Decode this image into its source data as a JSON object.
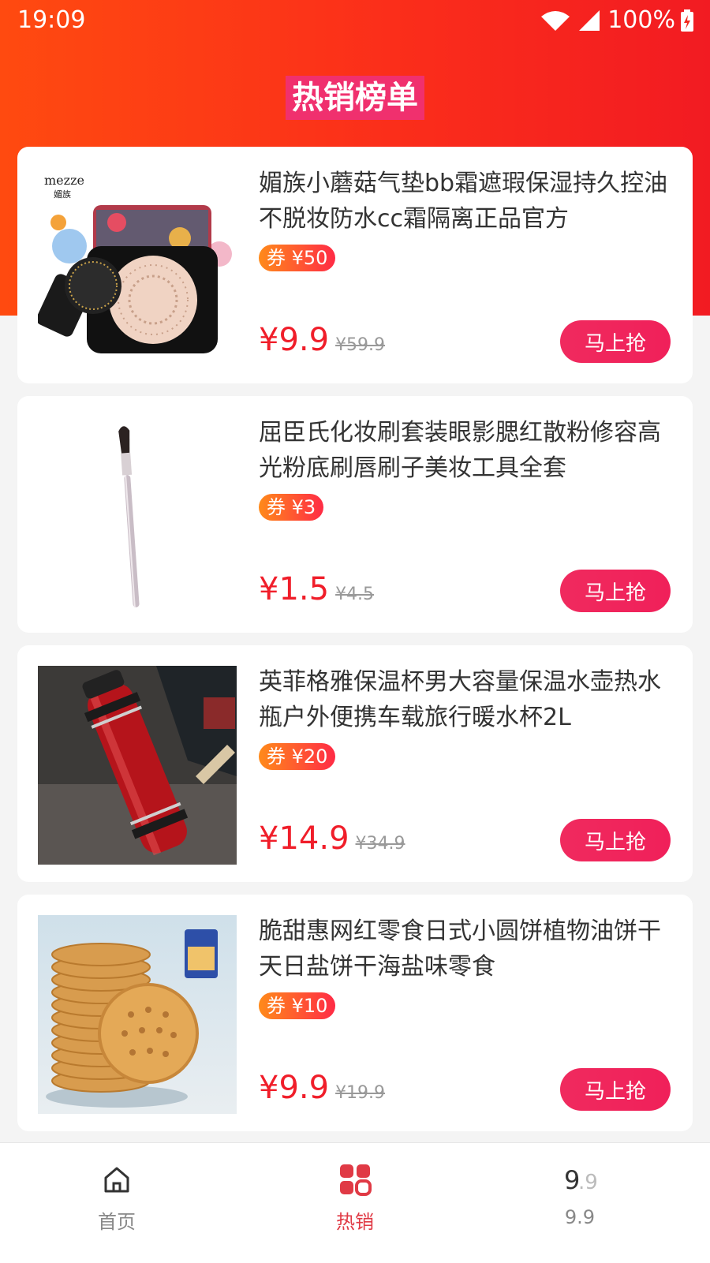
{
  "status_bar": {
    "time": "19:09",
    "battery": "100%"
  },
  "header": {
    "title": "热销榜单"
  },
  "products": [
    {
      "title": "媚族小蘑菇气垫bb霜遮瑕保湿持久控油不脱妆防水cc霜隔离正品官方",
      "coupon": "券 ¥50",
      "price": "¥9.9",
      "original_price": "¥59.9",
      "button": "马上抢",
      "image_brand": "mezze",
      "image_brand_cn": "媚族"
    },
    {
      "title": "屈臣氏化妆刷套装眼影腮红散粉修容高光粉底刷唇刷子美妆工具全套",
      "coupon": "券 ¥3",
      "price": "¥1.5",
      "original_price": "¥4.5",
      "button": "马上抢"
    },
    {
      "title": "英菲格雅保温杯男大容量保温水壶热水瓶户外便携车载旅行暖水杯2L",
      "coupon": "券 ¥20",
      "price": "¥14.9",
      "original_price": "¥34.9",
      "button": "马上抢"
    },
    {
      "title": "脆甜惠网红零食日式小圆饼植物油饼干天日盐饼干海盐味零食",
      "coupon": "券 ¥10",
      "price": "¥9.9",
      "original_price": "¥19.9",
      "button": "马上抢"
    }
  ],
  "tabbar": {
    "items": [
      {
        "label": "首页",
        "icon": "home-icon",
        "active": false
      },
      {
        "label": "热销",
        "icon": "grid-icon",
        "active": true
      },
      {
        "label": "9.9",
        "icon": "nine-nine-icon",
        "active": false
      }
    ]
  },
  "colors": {
    "header_start": "#ff4a10",
    "header_end": "#f21b22",
    "price": "#f01e2a",
    "button": "#f0205a",
    "active_tab": "#e03a45"
  }
}
